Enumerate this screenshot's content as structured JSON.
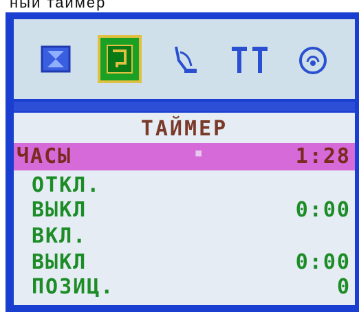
{
  "top_strip": "ный таймер         ",
  "icons": [
    {
      "name": "picture-icon"
    },
    {
      "name": "timer-icon",
      "selected": true
    },
    {
      "name": "antenna-icon"
    },
    {
      "name": "tools-icon"
    },
    {
      "name": "sound-icon"
    }
  ],
  "menu": {
    "title": "ТАЙМЕР",
    "rows": [
      {
        "label": "ЧАСЫ",
        "value": "1:28",
        "highlighted": true,
        "mid": "▪"
      },
      {
        "label": "ОТКЛ.",
        "value": ""
      },
      {
        "label": "ВЫКЛ",
        "value": "0:00"
      },
      {
        "label": "ВКЛ.",
        "value": ""
      },
      {
        "label": "ВЫКЛ",
        "value": "0:00"
      },
      {
        "label": "ПОЗИЦ.",
        "value": "0"
      }
    ]
  }
}
